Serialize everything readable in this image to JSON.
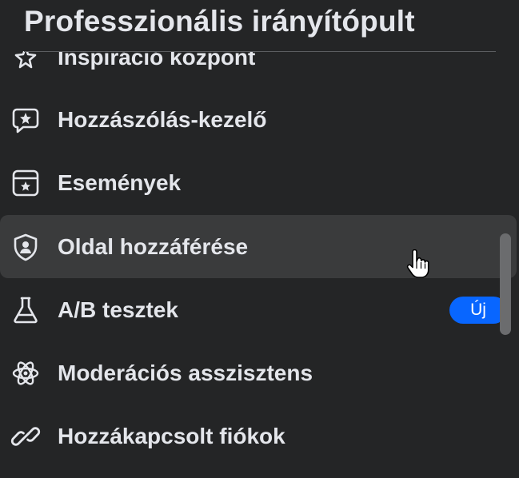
{
  "panel": {
    "title": "Professzionális irányítópult"
  },
  "items": [
    {
      "label": "Inspiráció központ",
      "icon": "sparkle-icon"
    },
    {
      "label": "Hozzászólás-kezelő",
      "icon": "star-comment-icon"
    },
    {
      "label": "Események",
      "icon": "calendar-star-icon"
    },
    {
      "label": "Oldal hozzáférése",
      "icon": "shield-person-icon",
      "active": true
    },
    {
      "label": "A/B tesztek",
      "icon": "flask-icon",
      "badge": "Új"
    },
    {
      "label": "Moderációs asszisztens",
      "icon": "atom-icon"
    },
    {
      "label": "Hozzákapcsolt fiókok",
      "icon": "link-icon"
    }
  ],
  "colors": {
    "background": "#242526",
    "active_row": "#3a3b3c",
    "text": "#e4e6eb",
    "badge": "#0866ff",
    "scrollbar": "#6b6c6e"
  }
}
